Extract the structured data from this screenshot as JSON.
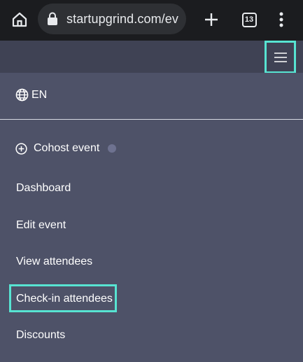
{
  "browser": {
    "url": "startupgrind.com/ev",
    "tab_count": "13",
    "icons": {
      "home": "home-icon",
      "lock": "lock-icon",
      "new_tab": "plus-icon",
      "tabs": "tab-switcher-icon",
      "menu": "more-vert-icon"
    }
  },
  "header": {
    "menu_icon": "hamburger-icon"
  },
  "menu": {
    "language": "EN",
    "cohost_label": "Cohost event",
    "items": [
      {
        "label": "Dashboard"
      },
      {
        "label": "Edit event"
      },
      {
        "label": "View attendees"
      },
      {
        "label": "Check-in attendees"
      },
      {
        "label": "Discounts"
      }
    ]
  },
  "colors": {
    "highlight": "#57e4d2",
    "menu_bg": "#4e5268",
    "header_bg": "#3f4254",
    "chrome_bg": "#1b1c1f"
  }
}
